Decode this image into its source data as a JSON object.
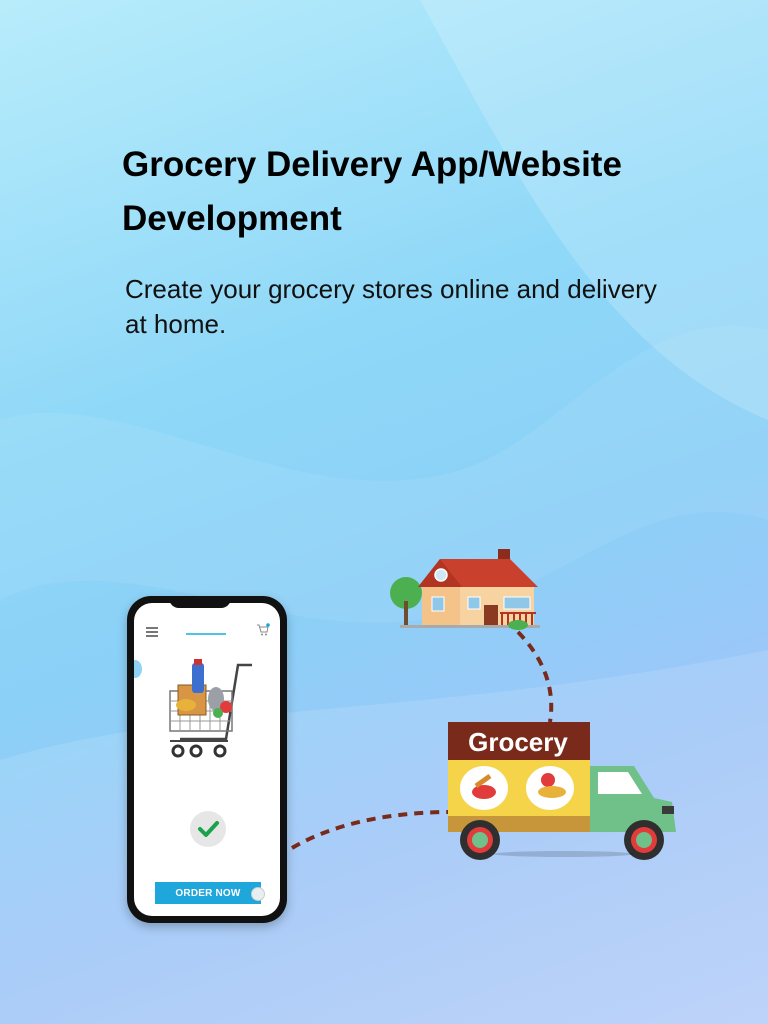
{
  "header": {
    "title": "Grocery Delivery App/Website Development",
    "subtitle": "Create your grocery stores online and delivery at home."
  },
  "phone": {
    "order_button_label": "ORDER NOW"
  },
  "truck": {
    "label": "Grocery"
  },
  "icons": [
    "menu-icon",
    "cart-icon",
    "check-icon",
    "house-icon",
    "truck-icon",
    "shopping-cart-icon"
  ],
  "colors": {
    "accent": "#1fa6db",
    "check": "#1aa34a",
    "truck_header": "#7a2a1a",
    "truck_body": "#f5d44a",
    "truck_cab": "#6fc089"
  }
}
